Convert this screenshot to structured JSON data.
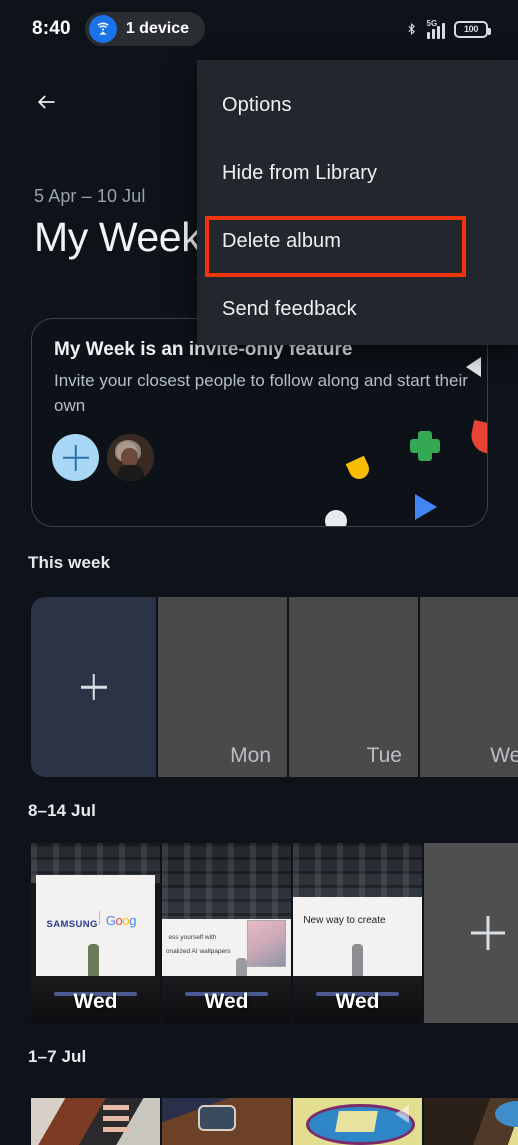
{
  "status_bar": {
    "time": "8:40",
    "hotspot": {
      "icon": "hotspot-icon",
      "label": "1 device"
    },
    "bluetooth_icon": "bluetooth-icon",
    "network": "5G",
    "signal_icon": "signal-bars-icon",
    "battery_level": "100"
  },
  "app_bar": {
    "back_icon": "back-arrow-icon"
  },
  "header": {
    "date_range": "5 Apr – 10 Jul",
    "title": "My Week"
  },
  "invite_card": {
    "title": "My Week is an invite-only feature",
    "subtitle": "Invite your closest people to follow along and start their own",
    "add_person_icon": "plus-icon",
    "avatar": "user-avatar"
  },
  "sections": [
    {
      "label": "This week",
      "tiles": [
        {
          "type": "add",
          "day": "",
          "icon": "plus-icon"
        },
        {
          "type": "empty",
          "day": "Mon"
        },
        {
          "type": "empty",
          "day": "Tue"
        },
        {
          "type": "empty",
          "day": "Wed"
        }
      ]
    },
    {
      "label": "8–14 Jul",
      "tiles": [
        {
          "type": "photo",
          "day": "Wed",
          "caption": "SAMSUNG | Google"
        },
        {
          "type": "photo",
          "day": "Wed",
          "caption": "ess yourself with onalized AI wallpapers"
        },
        {
          "type": "photo",
          "day": "Wed",
          "caption": "New way to create"
        },
        {
          "type": "add",
          "day": "",
          "icon": "plus-icon"
        }
      ]
    },
    {
      "label": "1–7 Jul",
      "tiles": []
    }
  ],
  "photo_labels": {
    "samsung": "SAMSUNG",
    "google": "Google",
    "slide2_line1": "ess yourself with",
    "slide2_line2": "onalized AI wallpapers",
    "slide3": "New way to create"
  },
  "menu": {
    "items": [
      {
        "label": "Options"
      },
      {
        "label": "Hide from Library"
      },
      {
        "label": "Delete album"
      },
      {
        "label": "Send feedback"
      }
    ],
    "highlighted_index": 2,
    "highlight_color": "#f0340e"
  },
  "colors": {
    "background": "#0d1319",
    "menu_background": "#22272d",
    "accent_blue": "#1a73e8",
    "add_tile": "#2b3347",
    "empty_tile": "#4a4a4a",
    "avatar_add": "#a8d8f5"
  }
}
